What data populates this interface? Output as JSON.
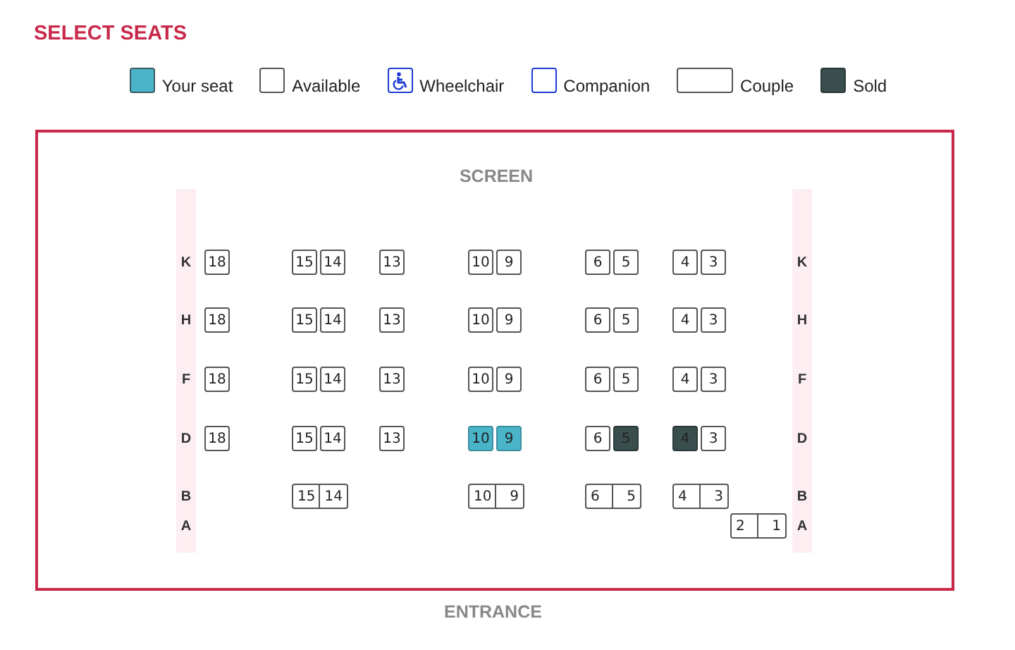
{
  "title": "SELECT SEATS",
  "legend": [
    {
      "kind": "yours",
      "label": "Your seat"
    },
    {
      "kind": "available",
      "label": "Available"
    },
    {
      "kind": "wheelchair",
      "label": "Wheelchair"
    },
    {
      "kind": "companion",
      "label": "Companion"
    },
    {
      "kind": "couple",
      "label": "Couple"
    },
    {
      "kind": "sold",
      "label": "Sold"
    }
  ],
  "screen_label": "SCREEN",
  "rows": [
    {
      "label_left": "K",
      "label_right": "K",
      "blocks": [
        {
          "kind": "single",
          "seats": [
            {
              "number": "18",
              "selected": false,
              "sold": false
            }
          ]
        },
        {
          "kind": "single",
          "seats": [
            {
              "number": "15",
              "selected": false,
              "sold": false
            },
            {
              "number": "14",
              "selected": false,
              "sold": false
            }
          ]
        },
        {
          "kind": "single",
          "seats": [
            {
              "number": "13",
              "selected": false,
              "sold": false
            }
          ]
        },
        {
          "kind": "single",
          "seats": [
            {
              "number": "10",
              "selected": false,
              "sold": false
            },
            {
              "number": "9",
              "selected": false,
              "sold": false
            }
          ]
        },
        {
          "kind": "single",
          "seats": [
            {
              "number": "6",
              "selected": false,
              "sold": false
            },
            {
              "number": "5",
              "selected": false,
              "sold": false
            }
          ]
        },
        {
          "kind": "single",
          "seats": [
            {
              "number": "4",
              "selected": false,
              "sold": false
            },
            {
              "number": "3",
              "selected": false,
              "sold": false
            }
          ]
        }
      ]
    },
    {
      "label_left": "H",
      "label_right": "H",
      "blocks": [
        {
          "kind": "single",
          "seats": [
            {
              "number": "18",
              "selected": false,
              "sold": false
            }
          ]
        },
        {
          "kind": "single",
          "seats": [
            {
              "number": "15",
              "selected": false,
              "sold": false
            },
            {
              "number": "14",
              "selected": false,
              "sold": false
            }
          ]
        },
        {
          "kind": "single",
          "seats": [
            {
              "number": "13",
              "selected": false,
              "sold": false
            }
          ]
        },
        {
          "kind": "single",
          "seats": [
            {
              "number": "10",
              "selected": false,
              "sold": false
            },
            {
              "number": "9",
              "selected": false,
              "sold": false
            }
          ]
        },
        {
          "kind": "single",
          "seats": [
            {
              "number": "6",
              "selected": false,
              "sold": false
            },
            {
              "number": "5",
              "selected": false,
              "sold": false
            }
          ]
        },
        {
          "kind": "single",
          "seats": [
            {
              "number": "4",
              "selected": false,
              "sold": false
            },
            {
              "number": "3",
              "selected": false,
              "sold": false
            }
          ]
        }
      ]
    },
    {
      "label_left": "F",
      "label_right": "F",
      "blocks": [
        {
          "kind": "single",
          "seats": [
            {
              "number": "18",
              "selected": false,
              "sold": false
            }
          ]
        },
        {
          "kind": "single",
          "seats": [
            {
              "number": "15",
              "selected": false,
              "sold": false
            },
            {
              "number": "14",
              "selected": false,
              "sold": false
            }
          ]
        },
        {
          "kind": "single",
          "seats": [
            {
              "number": "13",
              "selected": false,
              "sold": false
            }
          ]
        },
        {
          "kind": "single",
          "seats": [
            {
              "number": "10",
              "selected": false,
              "sold": false
            },
            {
              "number": "9",
              "selected": false,
              "sold": false
            }
          ]
        },
        {
          "kind": "single",
          "seats": [
            {
              "number": "6",
              "selected": false,
              "sold": false
            },
            {
              "number": "5",
              "selected": false,
              "sold": false
            }
          ]
        },
        {
          "kind": "single",
          "seats": [
            {
              "number": "4",
              "selected": false,
              "sold": false
            },
            {
              "number": "3",
              "selected": false,
              "sold": false
            }
          ]
        }
      ]
    },
    {
      "label_left": "D",
      "label_right": "D",
      "blocks": [
        {
          "kind": "single",
          "seats": [
            {
              "number": "18",
              "selected": false,
              "sold": false
            }
          ]
        },
        {
          "kind": "single",
          "seats": [
            {
              "number": "15",
              "selected": false,
              "sold": false
            },
            {
              "number": "14",
              "selected": false,
              "sold": false
            }
          ]
        },
        {
          "kind": "single",
          "seats": [
            {
              "number": "13",
              "selected": false,
              "sold": false
            }
          ]
        },
        {
          "kind": "single",
          "seats": [
            {
              "number": "10",
              "selected": true,
              "sold": false
            },
            {
              "number": "9",
              "selected": true,
              "sold": false
            }
          ]
        },
        {
          "kind": "single",
          "seats": [
            {
              "number": "6",
              "selected": false,
              "sold": false
            },
            {
              "number": "5",
              "selected": false,
              "sold": true
            }
          ]
        },
        {
          "kind": "single",
          "seats": [
            {
              "number": "4",
              "selected": false,
              "sold": true
            },
            {
              "number": "3",
              "selected": false,
              "sold": false
            }
          ]
        }
      ]
    },
    {
      "label_left": "B",
      "label_right": "B",
      "blocks": [
        {
          "kind": "empty"
        },
        {
          "kind": "couple",
          "seats": [
            {
              "number": "15",
              "selected": false,
              "sold": false
            },
            {
              "number": "14",
              "selected": false,
              "sold": false
            }
          ]
        },
        {
          "kind": "empty"
        },
        {
          "kind": "couple",
          "seats": [
            {
              "number": "10",
              "selected": false,
              "sold": false
            },
            {
              "number": "9",
              "selected": false,
              "sold": false
            }
          ]
        },
        {
          "kind": "couple",
          "seats": [
            {
              "number": "6",
              "selected": false,
              "sold": false
            },
            {
              "number": "5",
              "selected": false,
              "sold": false
            }
          ]
        },
        {
          "kind": "couple",
          "seats": [
            {
              "number": "4",
              "selected": false,
              "sold": false
            },
            {
              "number": "3",
              "selected": false,
              "sold": false
            }
          ]
        }
      ]
    },
    {
      "label_left": "A",
      "label_right": "A",
      "blocks": [
        {
          "kind": "empty"
        },
        {
          "kind": "empty"
        },
        {
          "kind": "empty"
        },
        {
          "kind": "empty"
        },
        {
          "kind": "empty"
        },
        {
          "kind": "empty"
        },
        {
          "kind": "couple",
          "seats": [
            {
              "number": "2",
              "selected": false,
              "sold": false
            },
            {
              "number": "1",
              "selected": false,
              "sold": false
            }
          ]
        }
      ]
    }
  ],
  "entrance_label": "ENTRANCE"
}
